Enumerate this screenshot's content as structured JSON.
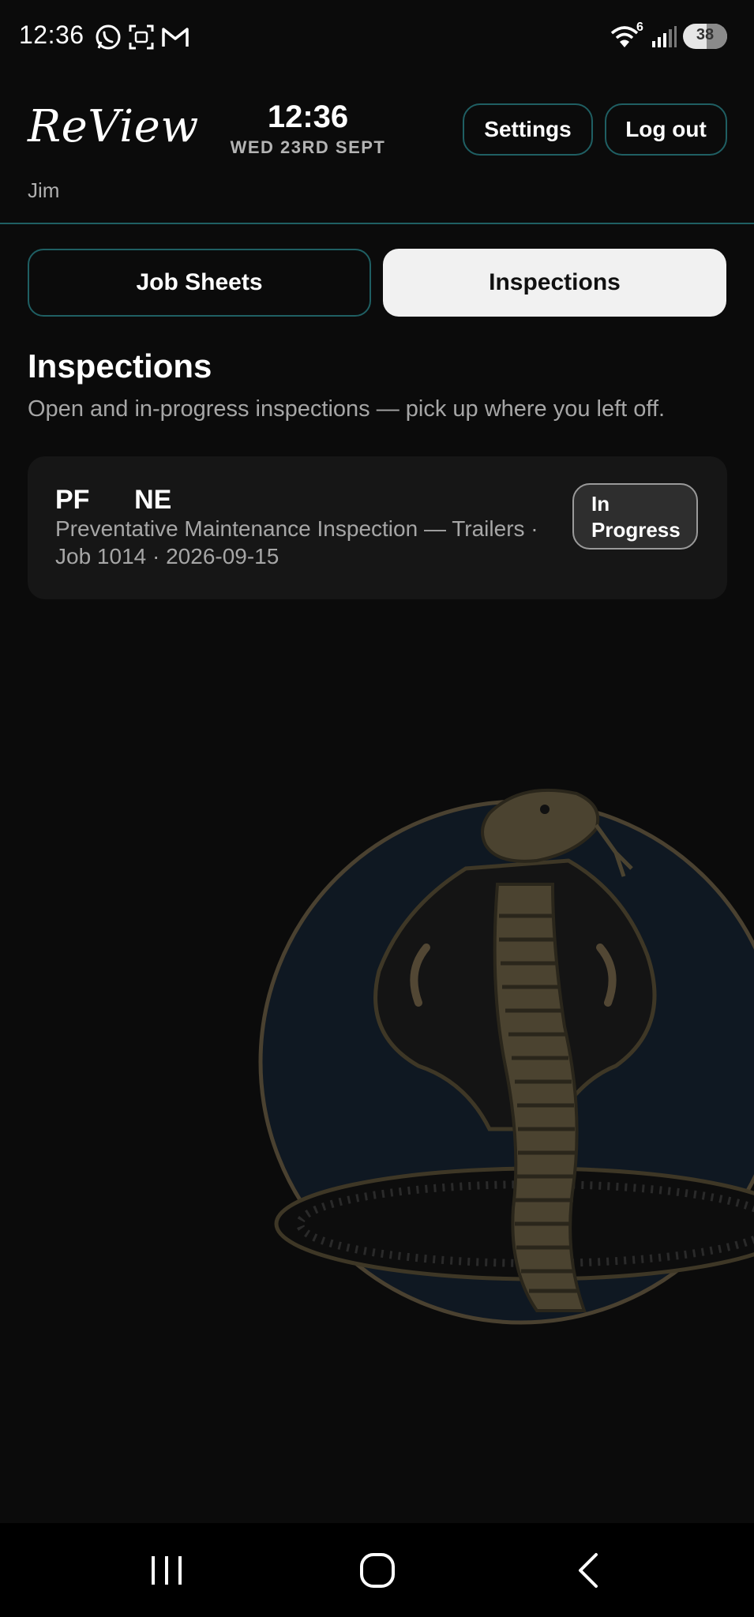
{
  "status_bar": {
    "time": "12:36",
    "notification_icons": [
      "whatsapp-icon",
      "screenshot-icon",
      "gmail-icon"
    ],
    "wifi_badge": "6",
    "battery": "38"
  },
  "header": {
    "logo": "ReView",
    "clock_time": "12:36",
    "clock_date": "WED 23RD SEPT",
    "settings_label": "Settings",
    "logout_label": "Log out",
    "user_name": "Jim"
  },
  "tabs": [
    {
      "label": "Job Sheets",
      "active": false
    },
    {
      "label": "Inspections",
      "active": true
    }
  ],
  "section": {
    "title": "Inspections",
    "subtitle": "Open and in-progress inspections — pick up where you left off."
  },
  "inspections": [
    {
      "title": "PF      NE",
      "description": "Preventative Maintenance Inspection — Trailers ·",
      "meta": "Job 1014 · 2026-09-15",
      "status": "In Progress"
    }
  ],
  "colors": {
    "background": "#0b0b0b",
    "accent_border": "#1f5f63",
    "active_tab": "#f1f1f1",
    "card": "#161616",
    "muted_text": "#a6a6a6"
  },
  "nav": [
    "recent-apps-icon",
    "home-icon",
    "back-icon"
  ]
}
